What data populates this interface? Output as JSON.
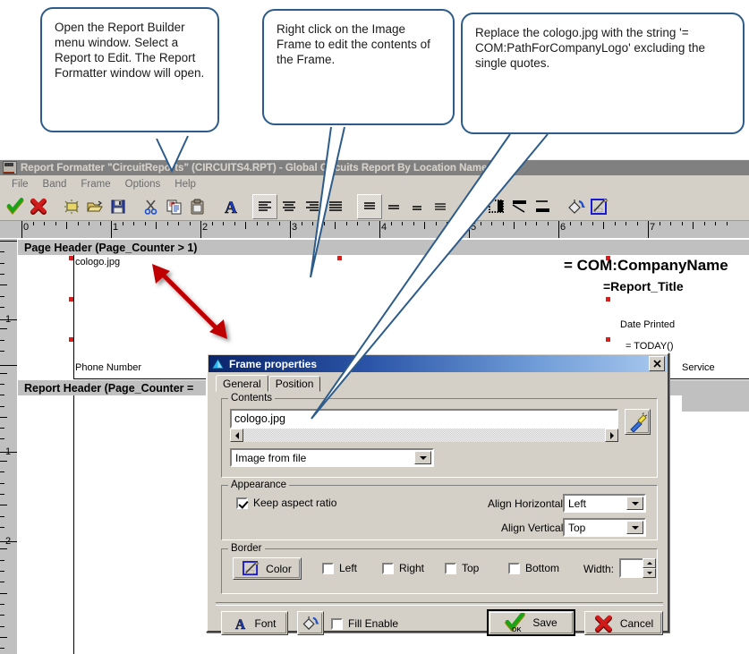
{
  "callouts": [
    {
      "id": "callout-open-report-builder",
      "text": "Open the Report Builder menu window. Select a Report to Edit. The Report Formatter window will open."
    },
    {
      "id": "callout-right-click-image-frame",
      "text": "Right click on the Image Frame to edit the contents of the Frame."
    },
    {
      "id": "callout-replace-cologo",
      "text": "Replace the cologo.jpg with the string '= COM:PathForCompanyLogo' excluding the single quotes."
    }
  ],
  "app": {
    "title": "Report Formatter \"CircuitReports\" (CIRCUITS4.RPT) - Global Circuits Report By Location Name",
    "icon": "report-formatter-icon",
    "menu": [
      "File",
      "Band",
      "Frame",
      "Options",
      "Help"
    ],
    "toolbar": [
      {
        "name": "accept-check-icon",
        "glyph": "check"
      },
      {
        "name": "cancel-cross-icon",
        "glyph": "cross"
      },
      {
        "name": "new-file-icon",
        "glyph": "newdoc"
      },
      {
        "name": "open-folder-icon",
        "glyph": "folder"
      },
      {
        "name": "save-disk-icon",
        "glyph": "disk"
      },
      {
        "name": "cut-scissors-icon",
        "glyph": "scissors"
      },
      {
        "name": "copy-icon",
        "glyph": "copy"
      },
      {
        "name": "paste-icon",
        "glyph": "paste"
      },
      {
        "name": "font-icon",
        "glyph": "fontA"
      },
      {
        "name": "align-left-icon",
        "glyph": "alignleft"
      },
      {
        "name": "align-center-icon",
        "glyph": "aligncenter"
      },
      {
        "name": "align-right-icon",
        "glyph": "alignright"
      },
      {
        "name": "align-justify-icon",
        "glyph": "alignjustify"
      },
      {
        "name": "valign-top-icon",
        "glyph": "vtop"
      },
      {
        "name": "valign-middle-icon",
        "glyph": "vmid"
      },
      {
        "name": "valign-bottom-icon",
        "glyph": "vbot"
      },
      {
        "name": "valign-stretch-icon",
        "glyph": "vstretch"
      },
      {
        "name": "border-none-icon",
        "glyph": "bnone"
      },
      {
        "name": "border-box-icon",
        "glyph": "bbox"
      },
      {
        "name": "border-shadow-icon",
        "glyph": "bshadow"
      },
      {
        "name": "border-frame-icon",
        "glyph": "bframe"
      },
      {
        "name": "fill-color-icon",
        "glyph": "paintcan"
      },
      {
        "name": "line-color-icon",
        "glyph": "pencilbox"
      }
    ]
  },
  "ruler": {
    "horizontal_labels": [
      "0",
      "1",
      "2",
      "3",
      "4",
      "5",
      "6",
      "7"
    ],
    "vertical_labels": [
      "1",
      "1",
      "2"
    ],
    "units": "inches"
  },
  "canvas": {
    "bands": [
      {
        "name": "page-header-band",
        "label": "Page Header (Page_Counter > 1)"
      },
      {
        "name": "report-header-band",
        "label": "Report Header (Page_Counter ="
      }
    ],
    "fields": [
      {
        "name": "image-frame-cologo",
        "text": "cologo.jpg"
      },
      {
        "name": "phone-number-label",
        "text": "Phone Number"
      },
      {
        "name": "company-name-field",
        "text": "= COM:CompanyName"
      },
      {
        "name": "report-title-field",
        "text": "=Report_Title"
      },
      {
        "name": "date-printed-label",
        "text": "Date Printed"
      },
      {
        "name": "today-field",
        "text": "= TODAY()"
      },
      {
        "name": "service-label",
        "text": "Service"
      }
    ]
  },
  "dialog": {
    "title": "Frame properties",
    "icon": "blue-triangle-icon",
    "close_label": "✕",
    "tabs": [
      {
        "label": "General",
        "active": true
      },
      {
        "label": "Position",
        "active": false
      }
    ],
    "contents_group": {
      "label": "Contents",
      "value": "cologo.jpg",
      "source_select": "Image from file",
      "browse_icon": "magic-wand-icon",
      "scroll_left": "◄",
      "scroll_right": "►"
    },
    "appearance_group": {
      "label": "Appearance",
      "keep_aspect_ratio": {
        "label": "Keep aspect ratio",
        "checked": true
      },
      "align_horizontal": {
        "label": "Align Horizontal:",
        "value": "Left"
      },
      "align_vertical": {
        "label": "Align Vertical:",
        "value": "Top"
      }
    },
    "border_group": {
      "label": "Border",
      "color_button": "Color",
      "color_icon": "pencil-box-icon",
      "checks": [
        {
          "label": "Left",
          "checked": false
        },
        {
          "label": "Right",
          "checked": false
        },
        {
          "label": "Top",
          "checked": false
        },
        {
          "label": "Bottom",
          "checked": false
        }
      ],
      "width_label": "Width:",
      "width_value": ""
    },
    "footer": {
      "font_button": {
        "label": "Font",
        "icon": "font-A-icon"
      },
      "fill_button_icon": "paint-can-icon",
      "fill_enable": {
        "label": "Fill Enable",
        "checked": false
      },
      "save_button": {
        "label": "Save",
        "icon": "green-check-ok-icon"
      },
      "cancel_button": {
        "label": "Cancel",
        "icon": "red-x-icon"
      }
    }
  },
  "colors": {
    "face": "#d4d0c8",
    "title_inactive": "#808080",
    "dialog_title_start": "#0a246a",
    "dialog_title_end": "#a9c9ef",
    "callout_border": "#2e5c8a",
    "handle_red": "#e01b1b",
    "arrow_red": "#c00000"
  }
}
